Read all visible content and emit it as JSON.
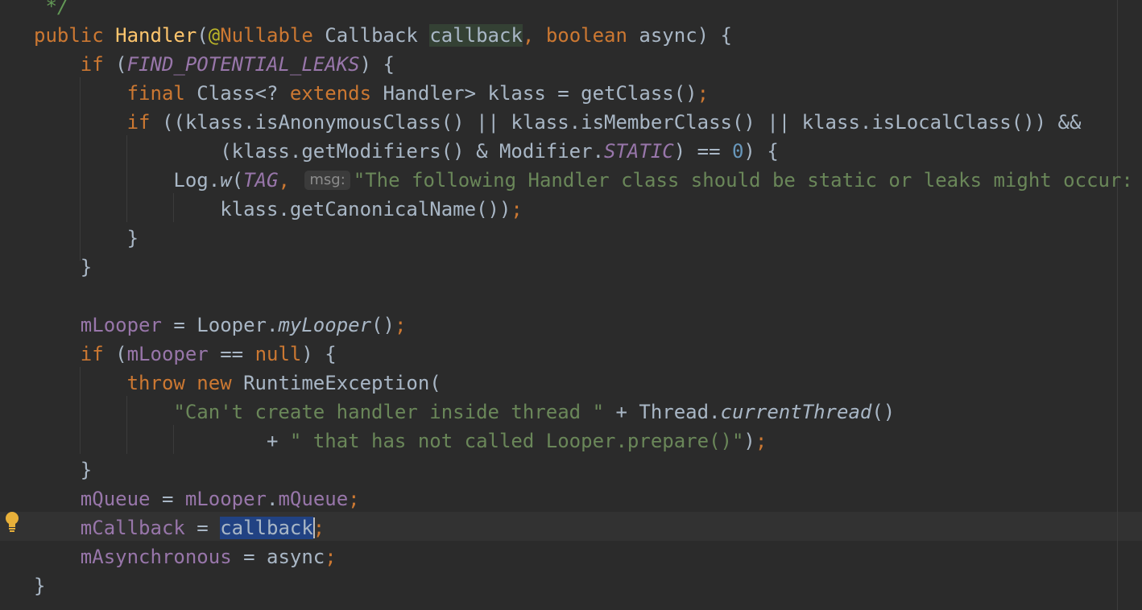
{
  "editor": {
    "lines": [
      {
        "tokens": [
          {
            "t": " ",
            "c": ""
          },
          {
            "t": "*/",
            "c": "cm"
          }
        ]
      },
      {
        "tokens": [
          {
            "t": "public ",
            "c": "k"
          },
          {
            "t": "Handler",
            "c": "m"
          },
          {
            "t": "(",
            "c": ""
          },
          {
            "t": "@",
            "c": "an"
          },
          {
            "t": "Nullable ",
            "c": "k"
          },
          {
            "t": "Callback ",
            "c": ""
          },
          {
            "t": "callback",
            "c": "hl-param"
          },
          {
            "t": ", ",
            "c": "k"
          },
          {
            "t": "boolean ",
            "c": "k"
          },
          {
            "t": "async) {",
            "c": ""
          }
        ]
      },
      {
        "tokens": [
          {
            "t": "    ",
            "c": ""
          },
          {
            "t": "if ",
            "c": "k"
          },
          {
            "t": "(",
            "c": ""
          },
          {
            "t": "FIND_POTENTIAL_LEAKS",
            "c": "fi"
          },
          {
            "t": ") {",
            "c": ""
          }
        ]
      },
      {
        "tokens": [
          {
            "t": "        ",
            "c": ""
          },
          {
            "t": "final ",
            "c": "k"
          },
          {
            "t": "Class<? ",
            "c": ""
          },
          {
            "t": "extends ",
            "c": "k"
          },
          {
            "t": "Handler> klass = getClass()",
            "c": ""
          },
          {
            "t": ";",
            "c": "k"
          }
        ]
      },
      {
        "tokens": [
          {
            "t": "        ",
            "c": ""
          },
          {
            "t": "if ",
            "c": "k"
          },
          {
            "t": "((klass.isAnonymousClass() || klass.isMemberClass() || klass.isLocalClass()) &&",
            "c": ""
          }
        ]
      },
      {
        "tokens": [
          {
            "t": "                (klass.getModifiers() & Modifier.",
            "c": ""
          },
          {
            "t": "STATIC",
            "c": "fi"
          },
          {
            "t": ") == ",
            "c": ""
          },
          {
            "t": "0",
            "c": "n"
          },
          {
            "t": ") {",
            "c": ""
          }
        ]
      },
      {
        "tokens": [
          {
            "t": "            Log.",
            "c": ""
          },
          {
            "t": "w",
            "c": "mi"
          },
          {
            "t": "(",
            "c": ""
          },
          {
            "t": "TAG",
            "c": "fi"
          },
          {
            "t": ", ",
            "c": "k"
          },
          {
            "t": "msg:",
            "c": "hint"
          },
          {
            "t": "\"The following Handler class should be static or leaks might occur: \"",
            "c": "s"
          }
        ]
      },
      {
        "tokens": [
          {
            "t": "                klass.getCanonicalName())",
            "c": ""
          },
          {
            "t": ";",
            "c": "k"
          }
        ]
      },
      {
        "tokens": [
          {
            "t": "        }",
            "c": ""
          }
        ]
      },
      {
        "tokens": [
          {
            "t": "    }",
            "c": ""
          }
        ]
      },
      {
        "tokens": []
      },
      {
        "tokens": [
          {
            "t": "    ",
            "c": ""
          },
          {
            "t": "mLooper",
            "c": "f"
          },
          {
            "t": " = Looper.",
            "c": ""
          },
          {
            "t": "myLooper",
            "c": "mi"
          },
          {
            "t": "()",
            "c": ""
          },
          {
            "t": ";",
            "c": "k"
          }
        ]
      },
      {
        "tokens": [
          {
            "t": "    ",
            "c": ""
          },
          {
            "t": "if ",
            "c": "k"
          },
          {
            "t": "(",
            "c": ""
          },
          {
            "t": "mLooper",
            "c": "f"
          },
          {
            "t": " == ",
            "c": ""
          },
          {
            "t": "null",
            "c": "k"
          },
          {
            "t": ") {",
            "c": ""
          }
        ]
      },
      {
        "tokens": [
          {
            "t": "        ",
            "c": ""
          },
          {
            "t": "throw new ",
            "c": "k"
          },
          {
            "t": "RuntimeException(",
            "c": ""
          }
        ]
      },
      {
        "tokens": [
          {
            "t": "            ",
            "c": ""
          },
          {
            "t": "\"Can't create handler inside thread \"",
            "c": "s"
          },
          {
            "t": " + Thread.",
            "c": ""
          },
          {
            "t": "currentThread",
            "c": "mi"
          },
          {
            "t": "()",
            "c": ""
          }
        ]
      },
      {
        "tokens": [
          {
            "t": "                    + ",
            "c": ""
          },
          {
            "t": "\" that has not called Looper.prepare()\"",
            "c": "s"
          },
          {
            "t": ")",
            "c": ""
          },
          {
            "t": ";",
            "c": "k"
          }
        ]
      },
      {
        "tokens": [
          {
            "t": "    }",
            "c": ""
          }
        ]
      },
      {
        "tokens": [
          {
            "t": "    ",
            "c": ""
          },
          {
            "t": "mQueue",
            "c": "f"
          },
          {
            "t": " = ",
            "c": ""
          },
          {
            "t": "mLooper",
            "c": "f"
          },
          {
            "t": ".",
            "c": ""
          },
          {
            "t": "mQueue",
            "c": "f"
          },
          {
            "t": ";",
            "c": "k"
          }
        ]
      },
      {
        "tokens": [
          {
            "t": "    ",
            "c": ""
          },
          {
            "t": "mCallback",
            "c": "f"
          },
          {
            "t": " = ",
            "c": ""
          },
          {
            "t": "callback",
            "c": "hl-sel"
          },
          {
            "t": "",
            "c": "caret"
          },
          {
            "t": ";",
            "c": "k"
          }
        ]
      },
      {
        "tokens": [
          {
            "t": "    ",
            "c": ""
          },
          {
            "t": "mAsynchronous",
            "c": "f"
          },
          {
            "t": " = async",
            "c": ""
          },
          {
            "t": ";",
            "c": "k"
          }
        ]
      },
      {
        "tokens": [
          {
            "t": "}",
            "c": ""
          }
        ]
      }
    ],
    "gutter": {
      "icon": "lightbulb-icon"
    },
    "colors": {
      "background": "#2b2b2b",
      "text": "#a9b7c6",
      "keyword": "#cc7832",
      "string": "#6a8759",
      "field": "#9876aa",
      "method_decl": "#ffc66d",
      "number": "#6897bb",
      "comment": "#629755",
      "annotation": "#bbb529",
      "selection": "#214283",
      "current_line": "#323232",
      "bulb": "#e8b03a"
    }
  }
}
